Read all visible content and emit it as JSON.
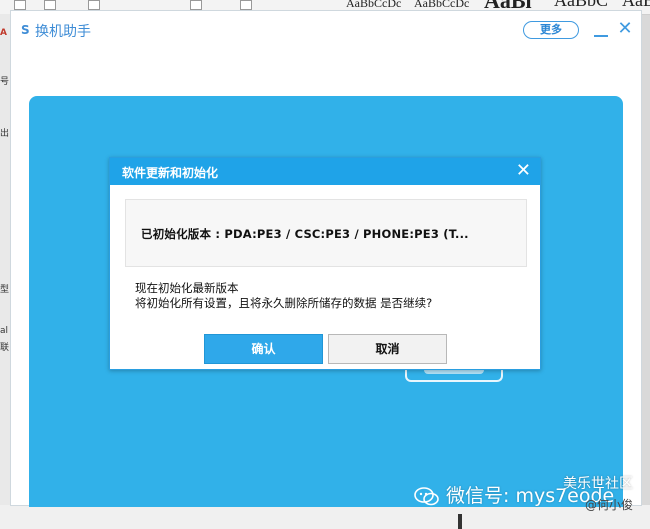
{
  "background_app": {
    "style_gallery": [
      "AaBbCcDc",
      "AaBbCcDc",
      "AaBl",
      "AaBbC",
      "AaB"
    ],
    "left_fragments": [
      "A",
      "号",
      "出",
      "型",
      "al",
      "联"
    ]
  },
  "app": {
    "icon_glyph": "S",
    "title": "换机助手",
    "more_label": "更多",
    "close_glyph": "✕"
  },
  "dialog": {
    "title": "软件更新和初始化",
    "close_glyph": "✕",
    "version_line": "已初始化版本 : PDA:PE3 / CSC:PE3 / PHONE:PE3 (T...",
    "message_line1": "现在初始化最新版本",
    "message_line2": "将初始化所有设置，且将永久删除所储存的数据 是否继续?",
    "confirm_label": "确认",
    "cancel_label": "取消"
  },
  "watermark": {
    "wechat_text": "微信号: mys7eode",
    "community_text": "美乐世社区",
    "author_text": "@何小俊"
  },
  "colors": {
    "panel_blue": "#31b1e9",
    "dialog_header": "#1fa3e8",
    "accent": "#3f8dd6"
  }
}
